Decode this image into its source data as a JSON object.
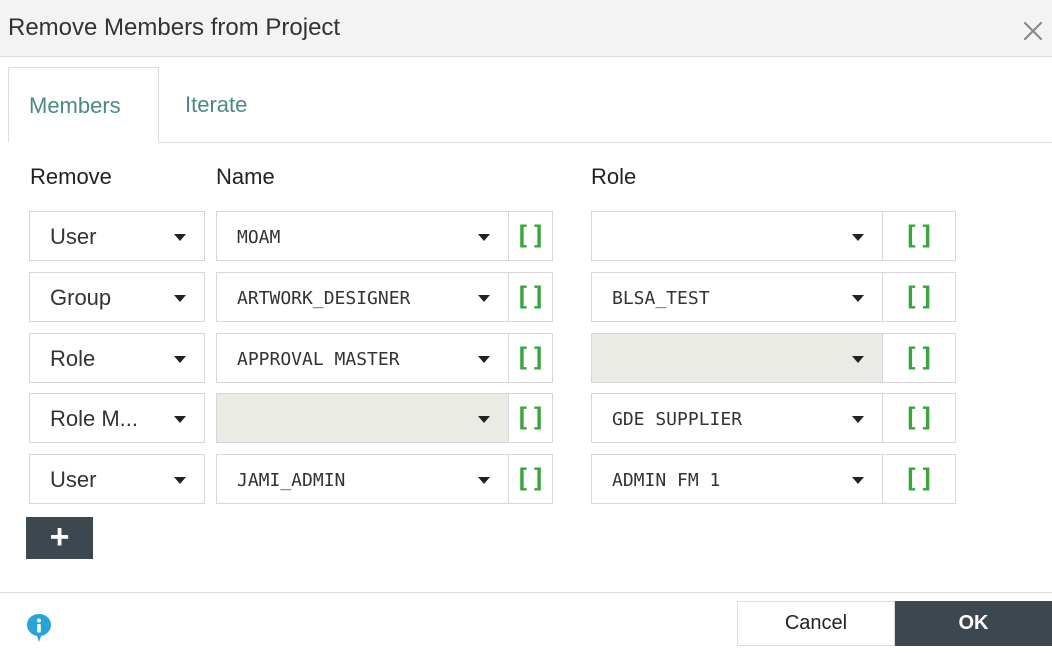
{
  "dialog": {
    "title": "Remove Members from Project"
  },
  "tabs": [
    {
      "label": "Members",
      "active": true
    },
    {
      "label": "Iterate",
      "active": false
    }
  ],
  "columns": {
    "remove": "Remove",
    "name": "Name",
    "role": "Role"
  },
  "rows": [
    {
      "type": "User",
      "name": "MOAM",
      "role": ""
    },
    {
      "type": "Group",
      "name": "ARTWORK_DESIGNER",
      "role": "BLSA_TEST"
    },
    {
      "type": "Role",
      "name": "APPROVAL MASTER",
      "role": ""
    },
    {
      "type": "Role M...",
      "name": "",
      "role": "GDE SUPPLIER"
    },
    {
      "type": "User",
      "name": "JAMI_ADMIN",
      "role": "ADMIN FM 1"
    }
  ],
  "bracket_label": "[]",
  "add_label": "+",
  "footer": {
    "cancel_label": "Cancel",
    "ok_label": "OK"
  },
  "colors": {
    "accent_teal": "#4a8a86",
    "bracket_green": "#3aa53a",
    "dark_button": "#3d4750",
    "info_blue": "#27a3d9",
    "disabled_field": "#ebebe5"
  },
  "icons": {
    "close": "close-icon",
    "info": "info-icon",
    "caret": "chevron-down-icon"
  }
}
